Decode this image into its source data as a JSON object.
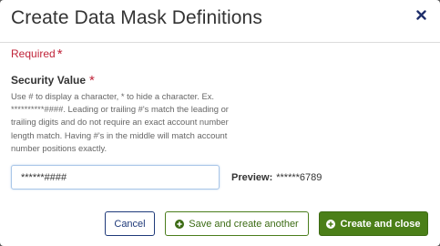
{
  "dialog": {
    "title": "Create Data Mask Definitions",
    "close_icon": "close-x-icon"
  },
  "form": {
    "required_text": "Required",
    "required_marker": "*",
    "security_value": {
      "label": "Security Value",
      "required_marker": "*",
      "help_text": "Use # to display a character, * to hide a character. Ex. **********####. Leading or trailing #'s match the leading or trailing digits and do not require an exact account number length match. Having #'s in the middle will match account number positions exactly.",
      "value": "******####"
    },
    "preview": {
      "label": "Preview:",
      "value": "******6789"
    }
  },
  "buttons": {
    "cancel": "Cancel",
    "save_another": "Save and create another",
    "create_close": "Create and close"
  },
  "colors": {
    "required": "#c0253a",
    "primary_green": "#4b7f18",
    "navy": "#1f3a7a"
  }
}
